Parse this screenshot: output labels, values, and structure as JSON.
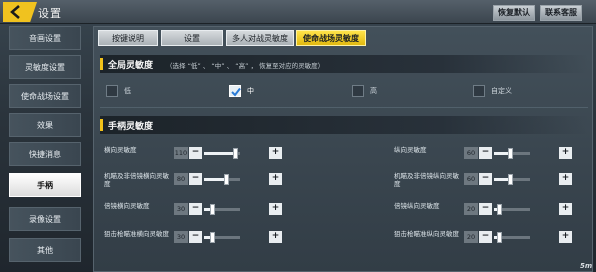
{
  "header": {
    "title": "设置",
    "restore_label": "恢复默认",
    "service_label": "联系客服"
  },
  "sidebar": {
    "items": [
      {
        "label": "音画设置"
      },
      {
        "label": "灵敏度设置"
      },
      {
        "label": "使命战场设置"
      },
      {
        "label": "效果"
      },
      {
        "label": "快捷消息"
      },
      {
        "label": "手柄",
        "active": true
      },
      {
        "label": "录像设置"
      },
      {
        "label": "其他"
      }
    ]
  },
  "tabs": [
    {
      "label": "按键说明"
    },
    {
      "label": "设置"
    },
    {
      "label": "多人对战灵敏度"
    },
    {
      "label": "使命战场灵敏度",
      "active": true
    }
  ],
  "global": {
    "title": "全局灵敏度",
    "note": "（选择 “低” 、 “中” 、 “高” ， 恢复至对应的灵敏度）",
    "options": [
      {
        "label": "低",
        "checked": false
      },
      {
        "label": "中",
        "checked": true
      },
      {
        "label": "高",
        "checked": false
      },
      {
        "label": "自定义",
        "checked": false
      }
    ]
  },
  "gamepad": {
    "title": "手柄灵敏度",
    "left": [
      {
        "label": "横向灵敏度",
        "value": "110",
        "fraction": 0.55
      },
      {
        "label": "机瞄及非倍镜横向灵敏度",
        "value": "80",
        "fraction": 0.4
      },
      {
        "label": "倍镜横向灵敏度",
        "value": "30",
        "fraction": 0.15
      },
      {
        "label": "狙击枪瞄准横向灵敏度",
        "value": "30",
        "fraction": 0.15
      }
    ],
    "right": [
      {
        "label": "纵向灵敏度",
        "value": "60",
        "fraction": 0.3
      },
      {
        "label": "机瞄及非倍镜纵向灵敏度",
        "value": "60",
        "fraction": 0.3
      },
      {
        "label": "倍镜纵向灵敏度",
        "value": "20",
        "fraction": 0.1
      },
      {
        "label": "狙击枪瞄准纵向灵敏度",
        "value": "20",
        "fraction": 0.1
      }
    ],
    "minus_symbol": "−",
    "plus_symbol": "+"
  },
  "watermark": "5m"
}
